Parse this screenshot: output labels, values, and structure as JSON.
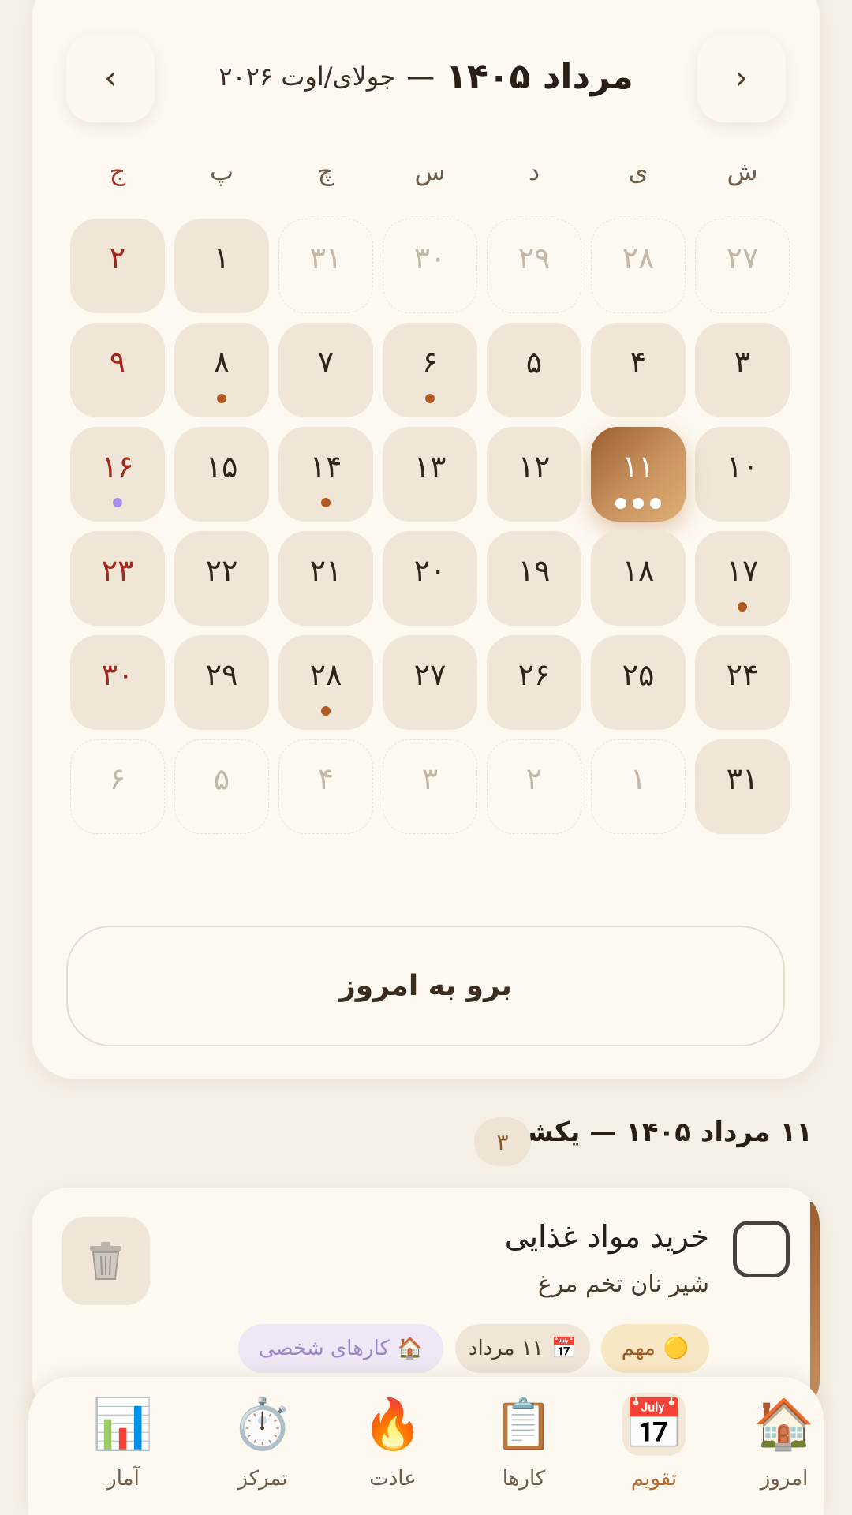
{
  "header": {
    "month_title": "مرداد ۱۴۰۵",
    "separator": "—",
    "gregorian_subtitle": "جولای/اوت ۲۰۲۶",
    "prev_label": "‹",
    "next_label": "›"
  },
  "weekdays": [
    "ش",
    "ی",
    "د",
    "س",
    "چ",
    "پ",
    "ج"
  ],
  "weeks": [
    [
      {
        "label": "۲۷",
        "state": "other"
      },
      {
        "label": "۲۸",
        "state": "other"
      },
      {
        "label": "۲۹",
        "state": "other"
      },
      {
        "label": "۳۰",
        "state": "other"
      },
      {
        "label": "۳۱",
        "state": "other"
      },
      {
        "label": "۱",
        "state": "normal"
      },
      {
        "label": "۲",
        "state": "normal"
      }
    ],
    [
      {
        "label": "۳",
        "state": "normal"
      },
      {
        "label": "۴",
        "state": "normal"
      },
      {
        "label": "۵",
        "state": "normal"
      },
      {
        "label": "۶",
        "state": "normal",
        "dot": "brown"
      },
      {
        "label": "۷",
        "state": "normal"
      },
      {
        "label": "۸",
        "state": "normal",
        "dot": "brown"
      },
      {
        "label": "۹",
        "state": "normal"
      }
    ],
    [
      {
        "label": "۱۰",
        "state": "normal"
      },
      {
        "label": "۱۱",
        "state": "today",
        "dot": "triple"
      },
      {
        "label": "۱۲",
        "state": "normal"
      },
      {
        "label": "۱۳",
        "state": "normal"
      },
      {
        "label": "۱۴",
        "state": "normal",
        "dot": "brown"
      },
      {
        "label": "۱۵",
        "state": "normal"
      },
      {
        "label": "۱۶",
        "state": "normal",
        "dot": "purple"
      }
    ],
    [
      {
        "label": "۱۷",
        "state": "normal",
        "dot": "brown"
      },
      {
        "label": "۱۸",
        "state": "normal"
      },
      {
        "label": "۱۹",
        "state": "normal"
      },
      {
        "label": "۲۰",
        "state": "normal"
      },
      {
        "label": "۲۱",
        "state": "normal"
      },
      {
        "label": "۲۲",
        "state": "normal"
      },
      {
        "label": "۲۳",
        "state": "normal"
      }
    ],
    [
      {
        "label": "۲۴",
        "state": "normal"
      },
      {
        "label": "۲۵",
        "state": "normal"
      },
      {
        "label": "۲۶",
        "state": "normal"
      },
      {
        "label": "۲۷",
        "state": "normal"
      },
      {
        "label": "۲۸",
        "state": "normal",
        "dot": "brown"
      },
      {
        "label": "۲۹",
        "state": "normal"
      },
      {
        "label": "۳۰",
        "state": "normal"
      }
    ],
    [
      {
        "label": "۳۱",
        "state": "normal"
      },
      {
        "label": "۱",
        "state": "other"
      },
      {
        "label": "۲",
        "state": "other"
      },
      {
        "label": "۳",
        "state": "other"
      },
      {
        "label": "۴",
        "state": "other"
      },
      {
        "label": "۵",
        "state": "other"
      },
      {
        "label": "۶",
        "state": "other"
      }
    ]
  ],
  "go_today_label": "برو به امروز",
  "selected_day": {
    "heading": "۱۱ مرداد ۱۴۰۵ — یکشنبه",
    "count": "۳"
  },
  "task": {
    "title": "خرید مواد غذایی",
    "description": "شیر نان تخم مرغ",
    "tags": {
      "priority": {
        "emoji": "🟡",
        "label": "مهم"
      },
      "date": {
        "emoji": "📅",
        "label": "۱۱ مرداد"
      },
      "category": {
        "emoji": "🏠",
        "label": "کارهای شخصی"
      }
    },
    "delete_emoji": "🗑️"
  },
  "bottom_nav": [
    {
      "key": "today",
      "emoji": "🏠",
      "label": "امروز"
    },
    {
      "key": "calendar",
      "emoji": "📅",
      "label": "تقویم",
      "active": true
    },
    {
      "key": "tasks",
      "emoji": "📋",
      "label": "کارها"
    },
    {
      "key": "habit",
      "emoji": "🔥",
      "label": "عادت"
    },
    {
      "key": "focus",
      "emoji": "⏱️",
      "label": "تمرکز"
    },
    {
      "key": "stats",
      "emoji": "📊",
      "label": "آمار"
    }
  ],
  "colors": {
    "accent": "#b36a2d",
    "friday": "#a3271d",
    "dot_brown": "#b25a1f",
    "dot_purple": "#a88ef0"
  }
}
